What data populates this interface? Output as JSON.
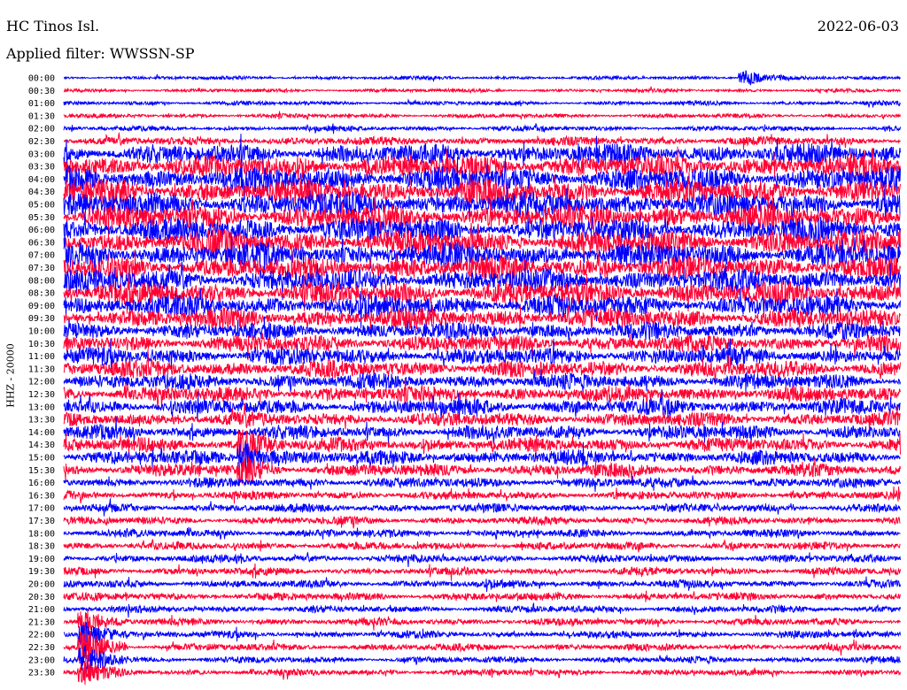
{
  "header": {
    "station": "HC Tinos Isl.",
    "date": "2022-06-03",
    "filter": "Applied filter: WWSSN-SP"
  },
  "chart_data": {
    "type": "line",
    "title": "HC Tinos Isl.",
    "subtitle": "Applied filter: WWSSN-SP",
    "ylabel": "HHZ - 20000",
    "xlabel": "",
    "minutes_per_row": 30,
    "row_labels": [
      "00:00",
      "00:30",
      "01:00",
      "01:30",
      "02:00",
      "02:30",
      "03:00",
      "03:30",
      "04:00",
      "04:30",
      "05:00",
      "05:30",
      "06:00",
      "06:30",
      "07:00",
      "07:30",
      "08:00",
      "08:30",
      "09:00",
      "09:30",
      "10:00",
      "10:30",
      "11:00",
      "11:30",
      "12:00",
      "12:30",
      "13:00",
      "13:30",
      "14:00",
      "14:30",
      "15:00",
      "15:30",
      "16:00",
      "16:30",
      "17:00",
      "17:30",
      "18:00",
      "18:30",
      "19:00",
      "19:30",
      "20:00",
      "20:30",
      "21:00",
      "21:30",
      "22:00",
      "22:30",
      "23:00",
      "23:30"
    ],
    "series_colors": [
      "#0000ff",
      "#ff0033"
    ],
    "relative_amplitude": [
      0.25,
      0.25,
      0.3,
      0.3,
      0.35,
      0.6,
      1.4,
      1.6,
      1.7,
      1.7,
      1.7,
      1.7,
      1.7,
      1.7,
      1.7,
      1.6,
      1.6,
      1.6,
      1.5,
      1.4,
      1.2,
      1.2,
      1.2,
      1.2,
      1.1,
      1.1,
      1.1,
      1.0,
      1.0,
      1.0,
      1.0,
      0.9,
      0.7,
      0.6,
      0.6,
      0.55,
      0.55,
      0.55,
      0.55,
      0.55,
      0.55,
      0.55,
      0.5,
      0.5,
      0.5,
      0.5,
      0.45,
      0.45
    ],
    "events": [
      {
        "row": 0,
        "minute": 24.5,
        "amplitude": 1.2
      },
      {
        "row": 29,
        "minute": 6.5,
        "amplitude": 2.2
      },
      {
        "row": 30,
        "minute": 6.5,
        "amplitude": 2.6
      },
      {
        "row": 31,
        "minute": 6.5,
        "amplitude": 1.8
      },
      {
        "row": 43,
        "minute": 0.8,
        "amplitude": 1.8
      },
      {
        "row": 44,
        "minute": 0.8,
        "amplitude": 2.6
      },
      {
        "row": 45,
        "minute": 0.8,
        "amplitude": 2.8
      },
      {
        "row": 46,
        "minute": 0.8,
        "amplitude": 2.4
      },
      {
        "row": 47,
        "minute": 0.8,
        "amplitude": 1.6
      }
    ]
  }
}
